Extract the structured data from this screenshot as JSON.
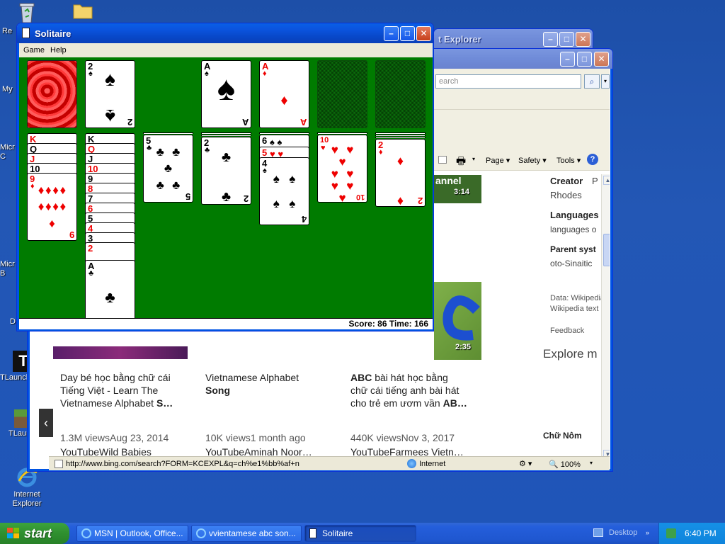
{
  "desktop": {
    "icons": [
      {
        "label": "Re"
      },
      {
        "label": ""
      },
      {
        "label": "My"
      },
      {
        "label": "Micr C"
      },
      {
        "label": "Micr B"
      },
      {
        "label": "D"
      },
      {
        "label": "TLaunch"
      },
      {
        "label": "TLaun"
      },
      {
        "label": "Internet Explorer"
      }
    ]
  },
  "ie_back": {
    "title": "t Explorer"
  },
  "ie": {
    "search_placeholder": "earch",
    "commands": {
      "page": "Page",
      "safety": "Safety",
      "tools": "Tools"
    },
    "videos": [
      {
        "duration": "3:14",
        "title_lines": [
          "annel"
        ],
        "meta": "",
        "source": ""
      },
      {
        "duration": "2:35"
      }
    ],
    "results": [
      {
        "title_line1": "Day bé học bằng chữ cái",
        "title_line2": "Tiếng Việt - Learn The",
        "title_line3_a": "Vietnamese Alphabet ",
        "title_line3_b": "S…",
        "meta": "1.3M viewsAug 23, 2014",
        "source": "YouTubeWild Babies"
      },
      {
        "title_line1": "Vietnamese Alphabet",
        "title_line2": "Song",
        "meta": "10K views1 month ago",
        "source": "YouTubeAminah Noor…"
      },
      {
        "title_line1_a": "ABC",
        "title_line1_b": " bài hát học bằng",
        "title_line2": "chữ cái tiếng anh bài hát",
        "title_line3_a": "cho trẻ em ươm vần ",
        "title_line3_b": "AB…",
        "meta": "440K viewsNov 3, 2017",
        "source": "YouTubeFarmees Vietn…"
      }
    ],
    "sidebar": {
      "creator_label": "Creator",
      "creator_value": "Rhodes",
      "creator_extra": "P",
      "languages_label": "Languages",
      "languages_value": "languages o",
      "parent_label": "Parent syst",
      "parent_value": "oto-Sinaitic",
      "data_line1": "Data: Wikipedia",
      "data_line2": "Wikipedia text",
      "feedback": "Feedback",
      "explore": "Explore m",
      "chu_nom": "Chữ Nôm"
    },
    "status_url": "http://www.bing.com/search?FORM=KCEXPL&q=ch%e1%bb%af+n",
    "status_zone": "Internet",
    "zoom": "100%"
  },
  "solitaire": {
    "title": "Solitaire",
    "menu": {
      "game": "Game",
      "help": "Help"
    },
    "status": "Score: 86 Time: 166",
    "waste_card": {
      "rank": "2",
      "suit": "♠",
      "color": "black"
    },
    "foundations": [
      {
        "rank": "A",
        "suit": "♠",
        "color": "black"
      },
      {
        "rank": "A",
        "suit": "♦",
        "color": "red"
      },
      {
        "empty": true
      },
      {
        "empty": true
      }
    ],
    "tableau": [
      {
        "visible_top": [
          {
            "rank": "K",
            "suit": "♥"
          },
          {
            "rank": "Q",
            "suit": "♠"
          },
          {
            "rank": "J",
            "suit": "♥"
          },
          {
            "rank": "10",
            "suit": "♠"
          }
        ],
        "face": {
          "rank": "9",
          "suit": "♦",
          "color": "red"
        }
      },
      {
        "visible_top": [
          {
            "rank": "K",
            "suit": "♠"
          },
          {
            "rank": "Q",
            "suit": "♥"
          },
          {
            "rank": "J",
            "suit": "♠"
          },
          {
            "rank": "10",
            "suit": "♥"
          },
          {
            "rank": "9",
            "suit": "♠"
          },
          {
            "rank": "8",
            "suit": "♥"
          },
          {
            "rank": "7",
            "suit": "♠"
          },
          {
            "rank": "6",
            "suit": "♥"
          },
          {
            "rank": "5",
            "suit": "♠"
          },
          {
            "rank": "4",
            "suit": "♥"
          },
          {
            "rank": "3",
            "suit": "♠"
          },
          {
            "rank": "2",
            "suit": "♥"
          }
        ],
        "face": {
          "rank": "A",
          "suit": "♣",
          "color": "black"
        }
      },
      {
        "visible_top": [],
        "face": {
          "rank": "5",
          "suit": "♣",
          "color": "black"
        }
      },
      {
        "visible_top": [],
        "face": {
          "rank": "2",
          "suit": "♣",
          "color": "black"
        }
      },
      {
        "visible_top": [
          {
            "rank": "6",
            "suit": "♠"
          },
          {
            "rank": "5",
            "suit": "♥"
          }
        ],
        "face": {
          "rank": "4",
          "suit": "♠",
          "color": "black"
        }
      },
      {
        "visible_top": [],
        "face": {
          "rank": "10",
          "suit": "♥",
          "color": "red"
        }
      },
      {
        "visible_top": [],
        "face": {
          "rank": "2",
          "suit": "♦",
          "color": "red"
        }
      }
    ]
  },
  "taskbar": {
    "start": "start",
    "buttons": [
      {
        "label": "MSN | Outlook, Office..."
      },
      {
        "label": "vvientamese abc son..."
      },
      {
        "label": "Solitaire"
      }
    ],
    "desktop_label": "Desktop",
    "clock": "6:40 PM"
  }
}
